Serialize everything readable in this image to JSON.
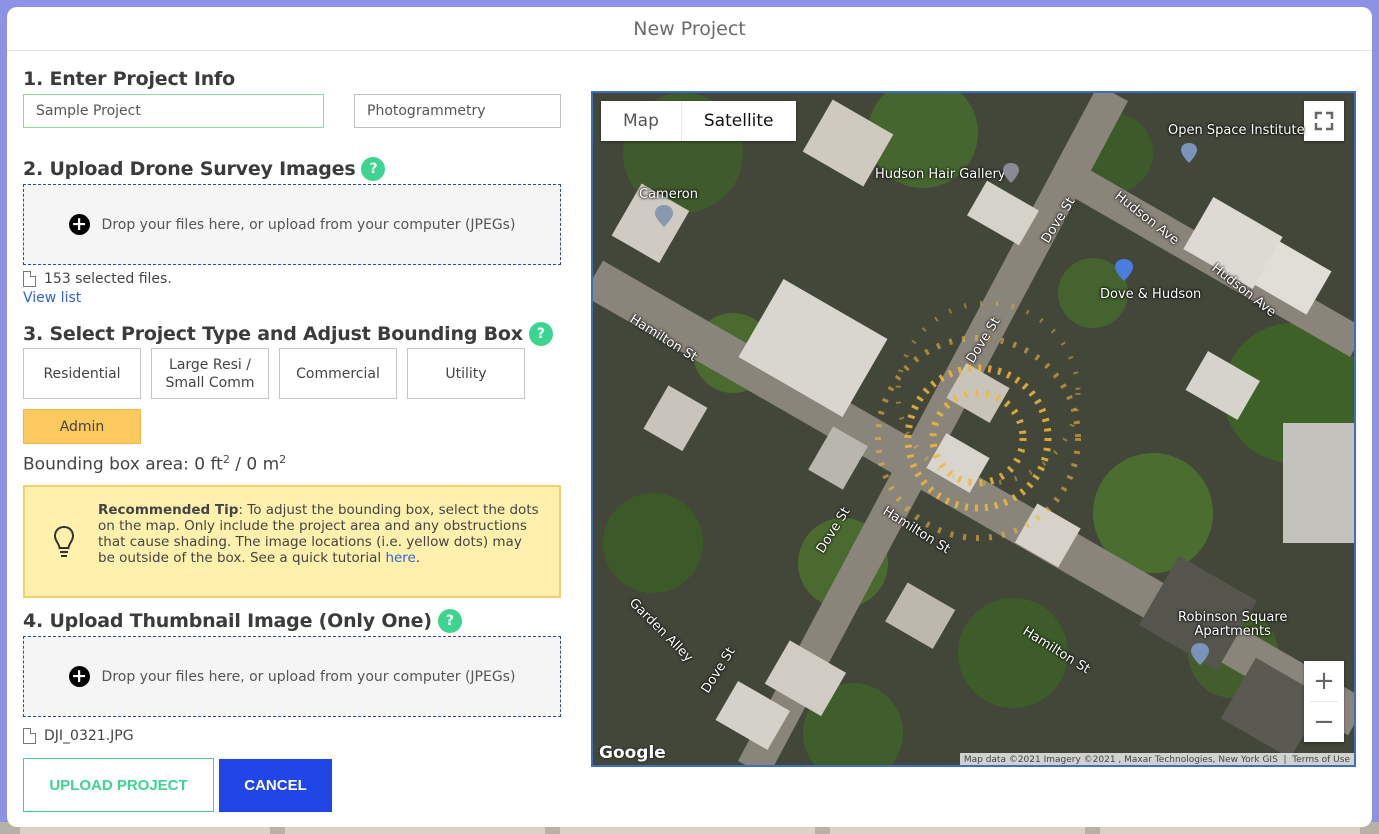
{
  "modal": {
    "title": "New Project"
  },
  "step1": {
    "heading": "1. Enter Project Info",
    "name_value": "Sample Project",
    "type_value": "Photogrammetry"
  },
  "step2": {
    "heading": "2. Upload Drone Survey Images",
    "help": "?",
    "drop_text": "Drop your files here, or upload from your computer (JPEGs)",
    "files_text": "153 selected files.",
    "view_list": "View list"
  },
  "step3": {
    "heading": "3. Select Project Type and Adjust Bounding Box",
    "help": "?",
    "types": [
      {
        "label": "Residential"
      },
      {
        "label": "Large Resi /\nSmall Comm"
      },
      {
        "label": "Commercial"
      },
      {
        "label": "Utility"
      },
      {
        "label": "Admin",
        "selected": true
      }
    ],
    "bbox_label": "Bounding box area: 0 ft",
    "bbox_sup1": "2",
    "bbox_sep": " / 0 m",
    "bbox_sup2": "2",
    "tip_title": "Recommended Tip",
    "tip_text": ": To adjust the bounding box, select the dots on the map. Only include the project area and any obstructions that cause shading. The image locations (i.e. yellow dots) may be outside of the box. See a quick tutorial ",
    "tip_link": "here",
    "tip_end": "."
  },
  "step4": {
    "heading": "4. Upload Thumbnail Image (Only One)",
    "help": "?",
    "drop_text": "Drop your files here, or upload from your computer (JPEGs)",
    "file_name": "DJI_0321.JPG"
  },
  "actions": {
    "upload": "UPLOAD PROJECT",
    "cancel": "CANCEL"
  },
  "map": {
    "toggle_map": "Map",
    "toggle_satellite": "Satellite",
    "zoom_in": "+",
    "zoom_out": "−",
    "logo": "Google",
    "attribution": "Map data ©2021 Imagery ©2021 , Maxar Technologies, New York GIS",
    "terms": "Terms of Use",
    "labels": {
      "open_space": "Open Space Institute",
      "hair_gallery": "Hudson Hair Gallery",
      "cameron": "Cameron",
      "dove_hudson": "Dove & Hudson",
      "robinson": "Robinson Square\nApartments",
      "hudson_ave": "Hudson Ave",
      "dove_st": "Dove St",
      "hamilton_st": "Hamilton St",
      "garden_alley": "Garden Alley"
    },
    "accent_color": "#f0b83a"
  }
}
